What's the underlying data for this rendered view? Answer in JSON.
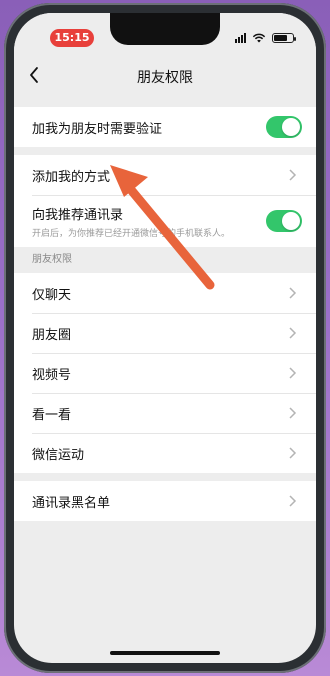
{
  "status_bar": {
    "time": "15:15"
  },
  "nav": {
    "back_icon": "chevron-left-icon",
    "title": "朋友权限"
  },
  "group1": {
    "verify_label": "加我为朋友时需要验证",
    "verify_on": true
  },
  "group2": {
    "add_methods_label": "添加我的方式",
    "recommend_label": "向我推荐通讯录",
    "recommend_desc": "开启后，为你推荐已经开通微信号的手机联系人。",
    "recommend_on": true
  },
  "friend_permissions": {
    "section_title": "朋友权限",
    "items": [
      {
        "label": "仅聊天"
      },
      {
        "label": "朋友圈"
      },
      {
        "label": "视频号"
      },
      {
        "label": "看一看"
      },
      {
        "label": "微信运动"
      }
    ]
  },
  "group4": {
    "blacklist_label": "通讯录黑名单"
  },
  "colors": {
    "accent_green": "#33C66B",
    "arrow_red": "#E8643B",
    "time_pill": "#E8403B"
  }
}
